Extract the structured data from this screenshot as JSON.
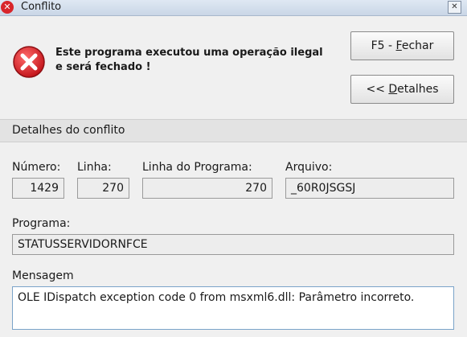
{
  "window": {
    "title": "Conflito",
    "close_glyph": "✕"
  },
  "error_icon": "error-x-icon",
  "message": {
    "line1": "Este programa executou uma operação ilegal",
    "line2": "e será fechado !"
  },
  "buttons": {
    "close_prefix": "F5 - ",
    "close_mnemonic": "F",
    "close_rest": "echar",
    "details_prefix": "<< ",
    "details_mnemonic": "D",
    "details_rest": "etalhes"
  },
  "section": {
    "title": "Detalhes do conflito"
  },
  "fields": {
    "numero": {
      "label": "Número:",
      "value": "1429"
    },
    "linha": {
      "label": "Linha:",
      "value": "270"
    },
    "linha_programa": {
      "label": "Linha do Programa:",
      "value": "270"
    },
    "arquivo": {
      "label": "Arquivo:",
      "value": "_60R0JSGSJ"
    },
    "programa": {
      "label": "Programa:",
      "value": "STATUSSERVIDORNFCE"
    },
    "mensagem": {
      "label": "Mensagem",
      "value": "OLE IDispatch exception code 0 from msxml6.dll: Parâmetro incorreto."
    }
  },
  "colors": {
    "error_red": "#d8262b",
    "focus_border": "#7aa3c9"
  }
}
